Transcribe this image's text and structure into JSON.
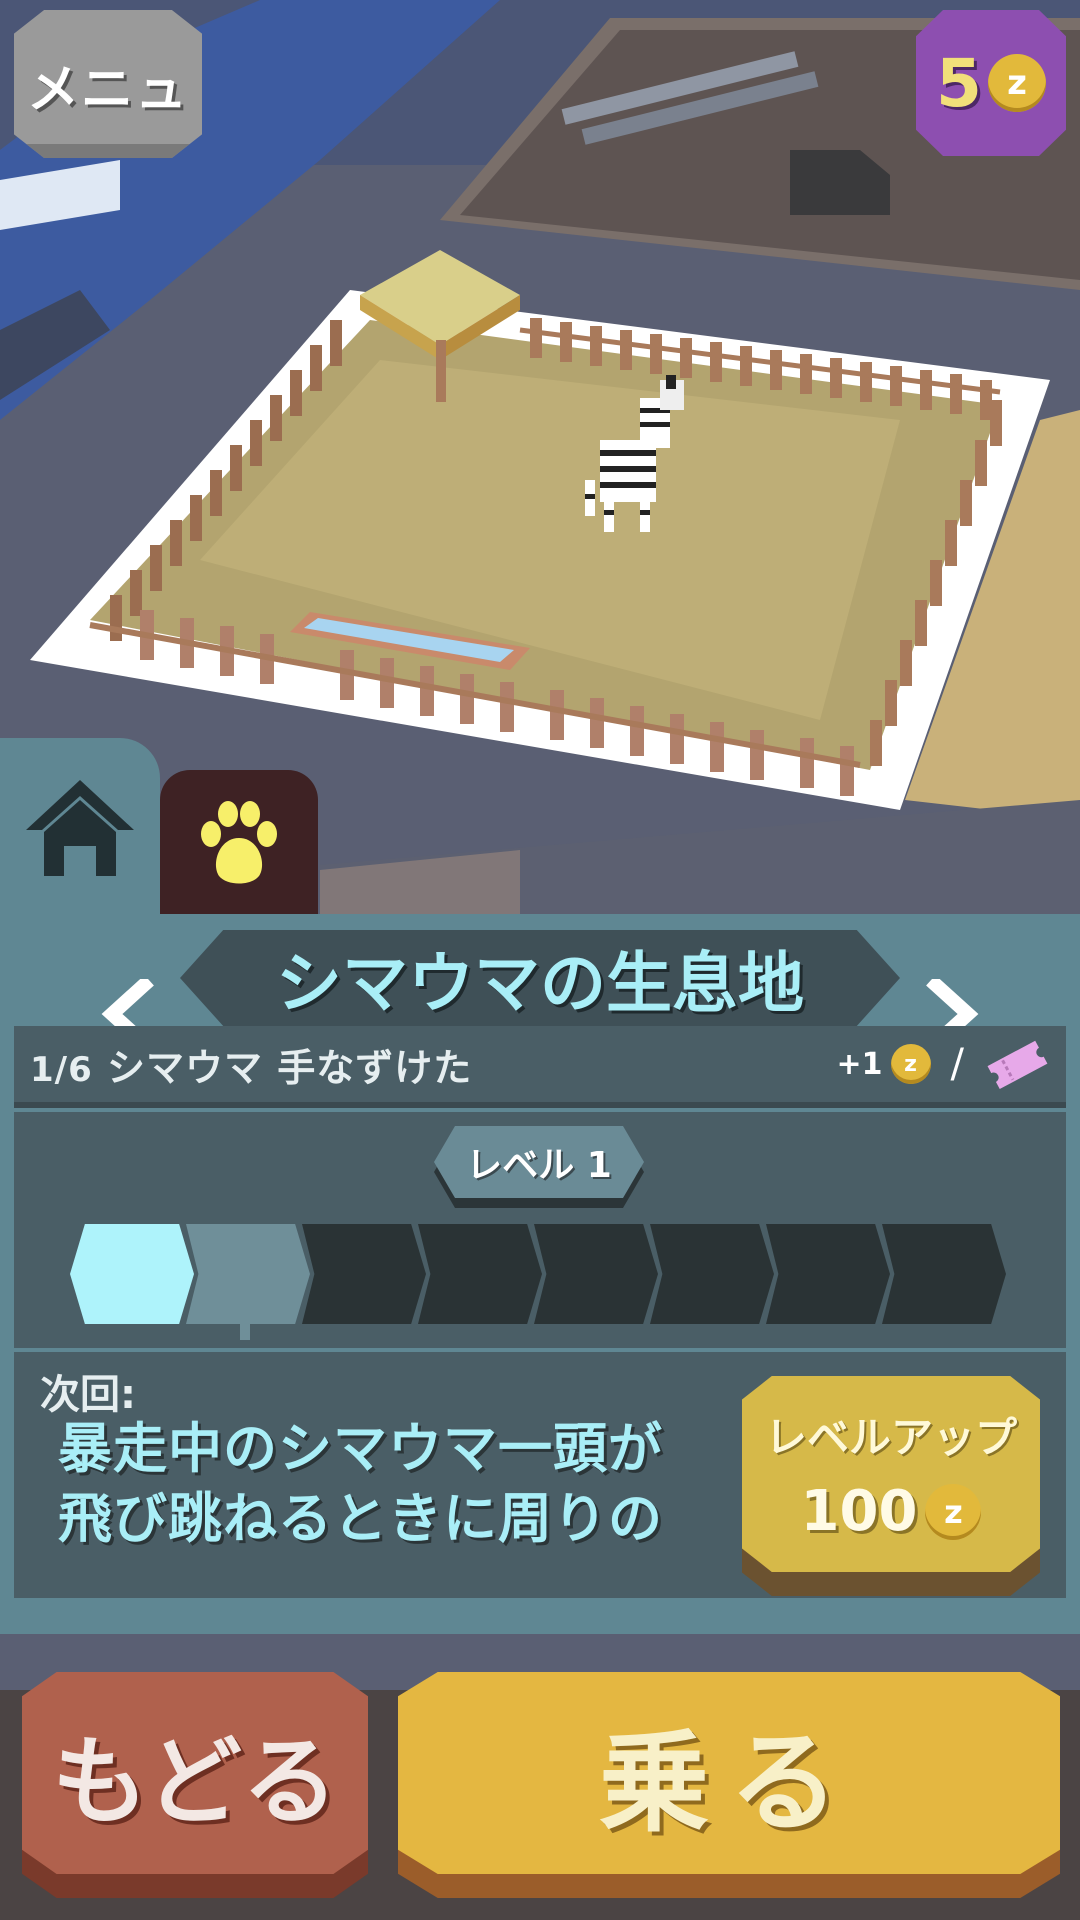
{
  "hud": {
    "menu_label": "メニュ",
    "coins": "5",
    "coin_symbol": "z"
  },
  "tabs": [
    {
      "icon": "home-icon"
    },
    {
      "icon": "paw-icon"
    }
  ],
  "panel": {
    "title": "シマウマの生息地",
    "tamed_fraction": "1/6",
    "tamed_text": "シマウマ 手なずけた",
    "reward": "+1",
    "separator": "/",
    "level_label": "レベル 1",
    "level_segments_total": 8,
    "level_segments_filled": 1,
    "next_label": "次回:",
    "next_desc_line1": "暴走中のシマウマ一頭が",
    "next_desc_line2": "飛び跳ねるときに周りの",
    "levelup_label": "レベルアップ",
    "levelup_cost": "100"
  },
  "buttons": {
    "back": "もどる",
    "ride": "乗る"
  },
  "colors": {
    "panel": "#5f8793",
    "accent_cyan": "#a9eef7",
    "coin_gold": "#e2b93b",
    "levelup": "#d6b949",
    "ride": "#e4b741",
    "back": "#b0614d",
    "coin_badge": "#8d4fb0"
  }
}
